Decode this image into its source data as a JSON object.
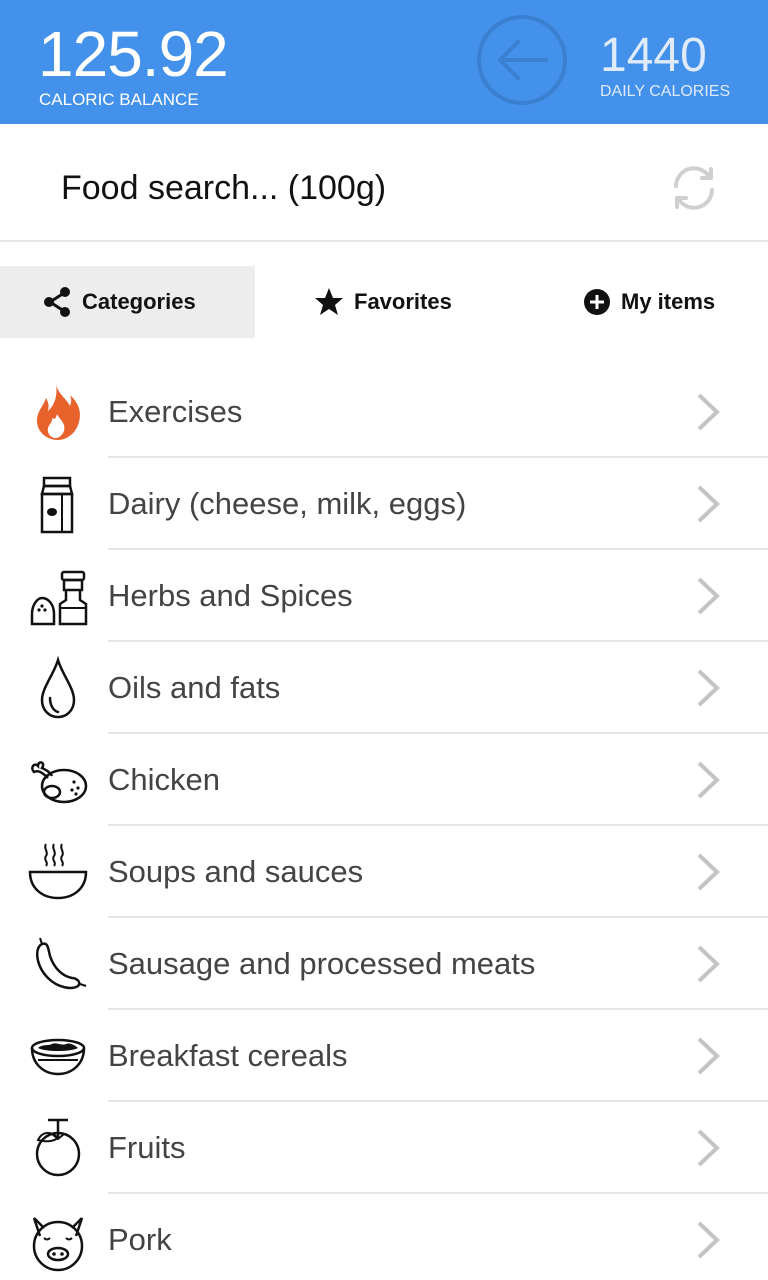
{
  "header": {
    "balance_value": "125.92",
    "balance_label": "CALORIC BALANCE",
    "daily_value": "1440",
    "daily_label": "DAILY CALORIES"
  },
  "search": {
    "placeholder": "Food search... (100g)"
  },
  "tabs": [
    {
      "label": "Categories",
      "icon": "share-icon",
      "active": true
    },
    {
      "label": "Favorites",
      "icon": "star-icon",
      "active": false
    },
    {
      "label": "My items",
      "icon": "plus-circle-icon",
      "active": false
    }
  ],
  "categories": [
    {
      "label": "Exercises",
      "icon": "flame-icon"
    },
    {
      "label": "Dairy (cheese, milk, eggs)",
      "icon": "milk-carton-icon"
    },
    {
      "label": "Herbs and Spices",
      "icon": "spice-grinder-icon"
    },
    {
      "label": "Oils and fats",
      "icon": "oil-drop-icon"
    },
    {
      "label": "Chicken",
      "icon": "roast-chicken-icon"
    },
    {
      "label": "Soups and sauces",
      "icon": "soup-bowl-icon"
    },
    {
      "label": "Sausage and processed meats",
      "icon": "sausage-icon"
    },
    {
      "label": "Breakfast cereals",
      "icon": "cereal-bowl-icon"
    },
    {
      "label": "Fruits",
      "icon": "fruit-icon"
    },
    {
      "label": "Pork",
      "icon": "pig-icon"
    }
  ],
  "colors": {
    "header_bg": "#4391ea",
    "flame": "#e8632c",
    "active_tab_bg": "#ededed"
  }
}
